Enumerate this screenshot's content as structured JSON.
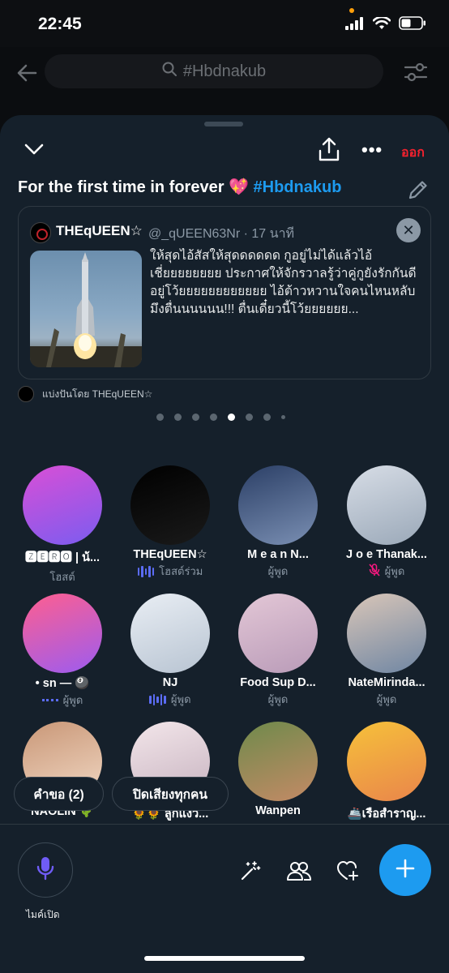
{
  "status_bar": {
    "time": "22:45"
  },
  "background": {
    "search_text": "#Hbdnakub"
  },
  "sheet": {
    "leave_label": "ออก",
    "title_text": "For the first time in forever 💖 ",
    "title_hashtag": "#Hbdnakub",
    "pinned_tweet": {
      "author_name": "THEqUEEN☆",
      "author_handle": "@_qUEEN63Nr · 17 นาที",
      "text": "ให้สุดไอ้สัสให้สุดดดดดด กูอยู่ไม่ได้แล้วไอ้เชี่ยยยยยยยย ประกาศให้จักรวาลรู้ว่าคู่กูยังรักกันดีอยู่โว้ยยยยยยยยยยยย ไอ้ต้าวหวานใจคนไหนหลับมึงตื่นนนนนน!!! ตื่นเดี๋ยวนี้โว้ยยยยยย..."
    },
    "shared_by": "แบ่งปันโดย THEqUEEN☆",
    "pager": {
      "count": 8,
      "active_index": 4
    }
  },
  "participants": [
    {
      "name": "🆉🅴🆁🅾 | น้...",
      "role": "โฮสต์",
      "indicator": "none",
      "colors": [
        "#d94fd6",
        "#7b5cf0"
      ]
    },
    {
      "name": "THEqUEEN☆",
      "role": "โฮสต์ร่วม",
      "indicator": "wave",
      "colors": [
        "#000000",
        "#1a1a1a"
      ]
    },
    {
      "name": "M e a n N...",
      "role": "ผู้พูด",
      "indicator": "none",
      "colors": [
        "#2b3f66",
        "#7a8fb3"
      ]
    },
    {
      "name": "J o e Thanak...",
      "role": "ผู้พูด",
      "indicator": "muted",
      "colors": [
        "#d7dde6",
        "#9aa8b8"
      ]
    },
    {
      "name": "• sn — 🎱",
      "role": "ผู้พูด",
      "indicator": "dotted",
      "colors": [
        "#ff5f8f",
        "#9c5cf0"
      ]
    },
    {
      "name": "NJ",
      "role": "ผู้พูด",
      "indicator": "wave",
      "colors": [
        "#e9eef4",
        "#b8c4d2"
      ]
    },
    {
      "name": "Food Sup D...",
      "role": "ผู้พูด",
      "indicator": "none",
      "colors": [
        "#e3c7d6",
        "#b99bb8"
      ]
    },
    {
      "name": "NateMirinda...",
      "role": "ผู้พูด",
      "indicator": "none",
      "colors": [
        "#d9c6b8",
        "#6f86a3"
      ]
    },
    {
      "name": "NAOLIN 🌵",
      "role": "",
      "indicator": "none",
      "colors": [
        "#c99777",
        "#f1d8c4"
      ]
    },
    {
      "name": "🌻🌻 ลูกแงว...",
      "role": "",
      "indicator": "none",
      "colors": [
        "#f3e6ea",
        "#c7b3c0"
      ]
    },
    {
      "name": "Wanpen",
      "role": "",
      "indicator": "none",
      "colors": [
        "#6e8a4b",
        "#c48a66"
      ]
    },
    {
      "name": "🚢เรือสำราญ...",
      "role": "",
      "indicator": "none",
      "colors": [
        "#f6c13a",
        "#e9854b"
      ]
    }
  ],
  "pills": {
    "requests": "คำขอ (2)",
    "mute_all": "ปิดเสียงทุกคน"
  },
  "bottom_bar": {
    "mic_label": "ไมค์เปิด"
  },
  "colors": {
    "accent": "#1d9bf0",
    "danger": "#f4212e",
    "sheet_bg": "#15202b",
    "wave": "#5b6cf5"
  }
}
